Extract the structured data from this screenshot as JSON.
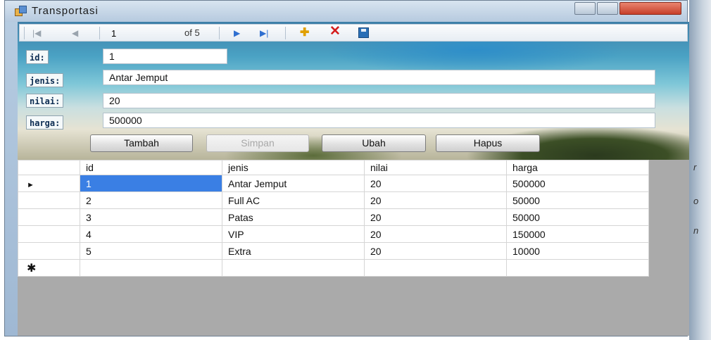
{
  "window": {
    "title": "Transportasi"
  },
  "navigator": {
    "position": "1",
    "of_text": "of 5"
  },
  "form": {
    "labels": {
      "id": "id:",
      "jenis": "jenis:",
      "nilai": "nilai:",
      "harga": "harga:"
    },
    "values": {
      "id": "1",
      "jenis": "Antar Jemput",
      "nilai": "20",
      "harga": "500000"
    }
  },
  "buttons": {
    "tambah": "Tambah",
    "simpan": "Simpan",
    "ubah": "Ubah",
    "hapus": "Hapus"
  },
  "grid": {
    "columns": [
      "id",
      "jenis",
      "nilai",
      "harga"
    ],
    "rows": [
      [
        "1",
        "Antar Jemput",
        "20",
        "500000"
      ],
      [
        "2",
        "Full AC",
        "20",
        "50000"
      ],
      [
        "3",
        "Patas",
        "20",
        "50000"
      ],
      [
        "4",
        "VIP",
        "20",
        "150000"
      ],
      [
        "5",
        "Extra",
        "20",
        "10000"
      ]
    ],
    "current_row_marker": "►",
    "new_row_marker": "✱"
  },
  "background_edge": [
    "r",
    "o",
    "n"
  ],
  "icons": {
    "app": "app-icon",
    "first": "move-first-icon",
    "previous": "move-previous-icon",
    "next": "move-next-icon",
    "last": "move-last-icon",
    "add": "add-new-icon",
    "delete": "delete-icon",
    "save": "save-icon"
  },
  "colors": {
    "selection": "#3a7fe4",
    "grid_bg": "#aaaaaa"
  }
}
